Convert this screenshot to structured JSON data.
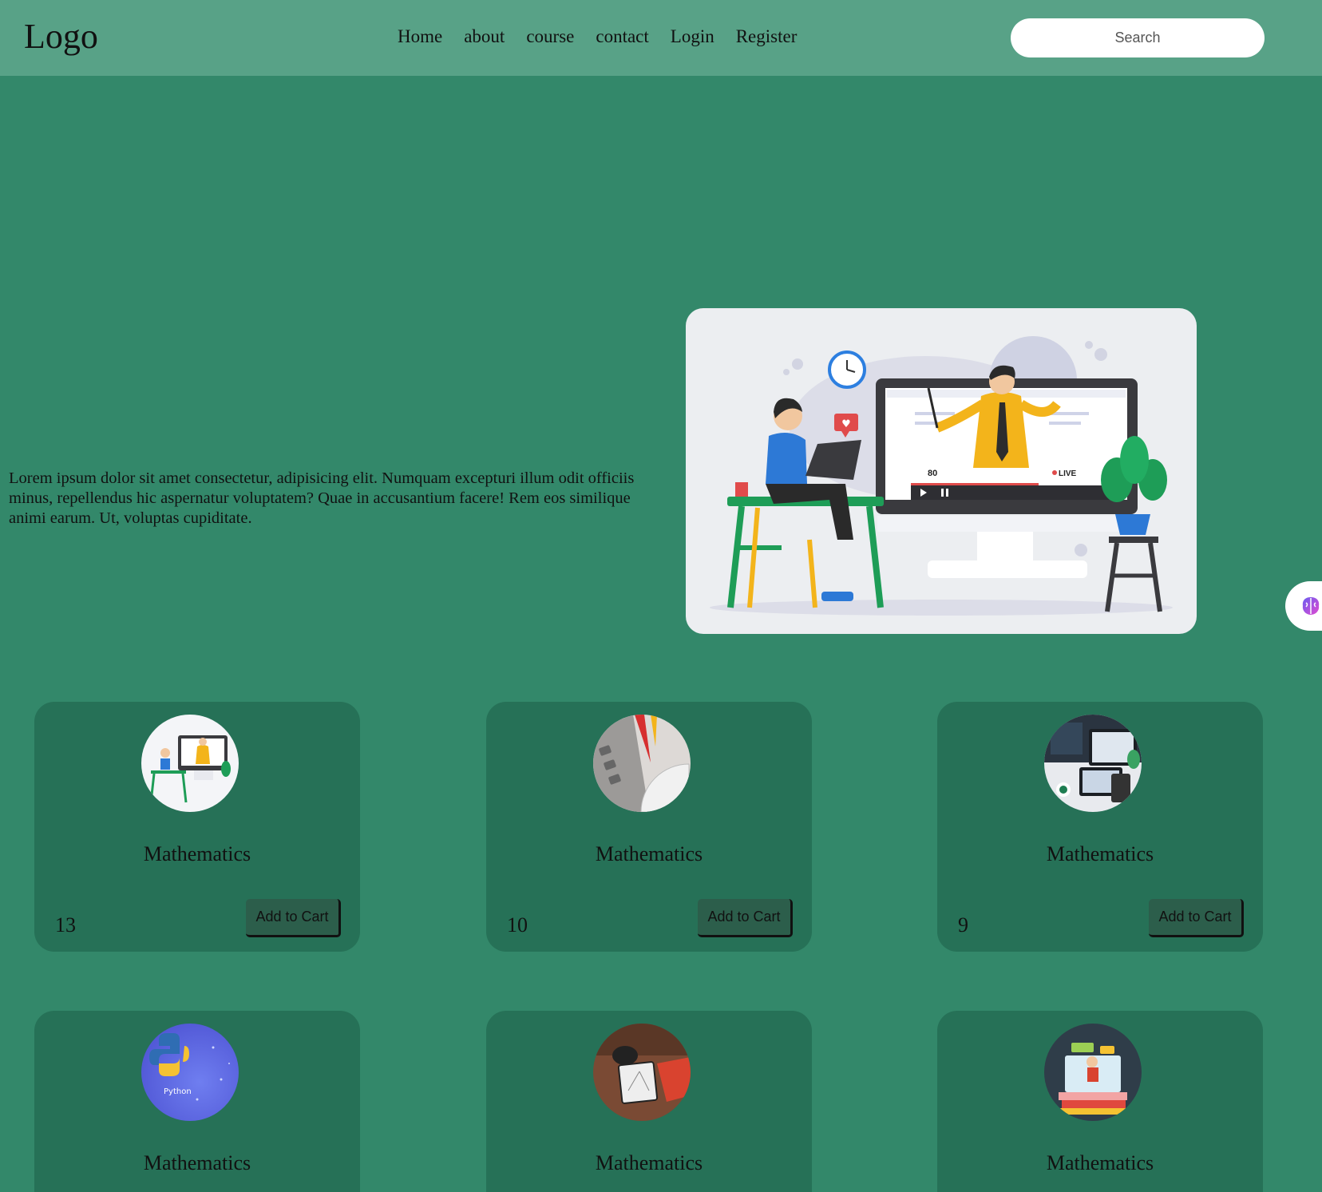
{
  "nav": {
    "logo": "Logo",
    "links": [
      "Home",
      "about",
      "course",
      "contact",
      "Login",
      "Register"
    ],
    "search_placeholder": "Search"
  },
  "hero": {
    "text": "Lorem ipsum dolor sit amet consectetur, adipisicing elit. Numquam excepturi illum odit officiis minus, repellendus hic aspernatur voluptatem? Quae in accusantium facere! Rem eos similique animi earum. Ut, voluptas cupiditate.",
    "illustration_labels": {
      "viewers": "80",
      "live": "LIVE"
    }
  },
  "courses": [
    {
      "title": "Mathematics",
      "price": "13",
      "button": "Add to Cart",
      "thumb": "online-class-illustration"
    },
    {
      "title": "Mathematics",
      "price": "10",
      "button": "Add to Cart",
      "thumb": "calculator-protractor-photo"
    },
    {
      "title": "Mathematics",
      "price": "9",
      "button": "Add to Cart",
      "thumb": "devices-desk-photo"
    },
    {
      "title": "Mathematics",
      "thumb": "python-logo"
    },
    {
      "title": "Mathematics",
      "thumb": "tablet-desk-photo"
    },
    {
      "title": "Mathematics",
      "thumb": "teacher-books-illustration"
    }
  ]
}
